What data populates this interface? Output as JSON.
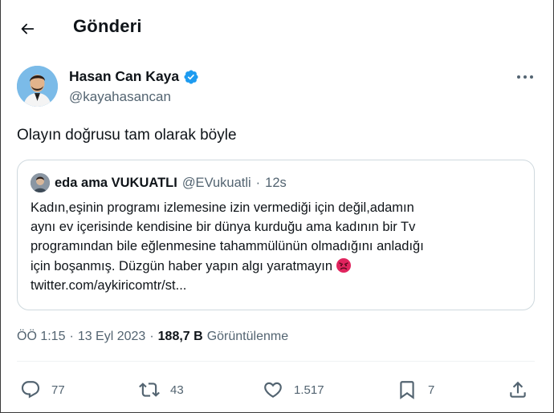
{
  "header": {
    "title": "Gönderi"
  },
  "author": {
    "name": "Hasan Can Kaya",
    "handle": "@kayahasancan",
    "verified": true
  },
  "tweet": {
    "text": "Olayın doğrusu tam olarak böyle"
  },
  "quote": {
    "name": "eda ama VUKUATLI",
    "handle": "@EVukuatli",
    "separator": "·",
    "time": "12s",
    "lines": [
      "Kadın,eşinin programı izlemesine izin vermediği için değil,adamın",
      "aynı ev içerisinde kendisine bir dünya kurduğu ama kadının bir Tv",
      "programından bile eğlenmesine tahammülünün olmadığını anladığı",
      "için boşanmış. Düzgün haber yapın algı yaratmayın",
      "twitter.com/aykiricomtr/st..."
    ],
    "emoji": "angry-face-icon"
  },
  "meta": {
    "time": "ÖÖ 1:15",
    "sep1": "·",
    "date": "13 Eyl 2023",
    "sep2": "·",
    "views": "188,7 B",
    "views_label": "Görüntülenme"
  },
  "actions": {
    "replies": "77",
    "retweets": "43",
    "likes": "1.517",
    "bookmarks": "7"
  },
  "colors": {
    "text": "#0f1419",
    "muted": "#536471",
    "verified": "#1d9bf0",
    "border": "#cfd9de",
    "angry": "#e0245e"
  }
}
